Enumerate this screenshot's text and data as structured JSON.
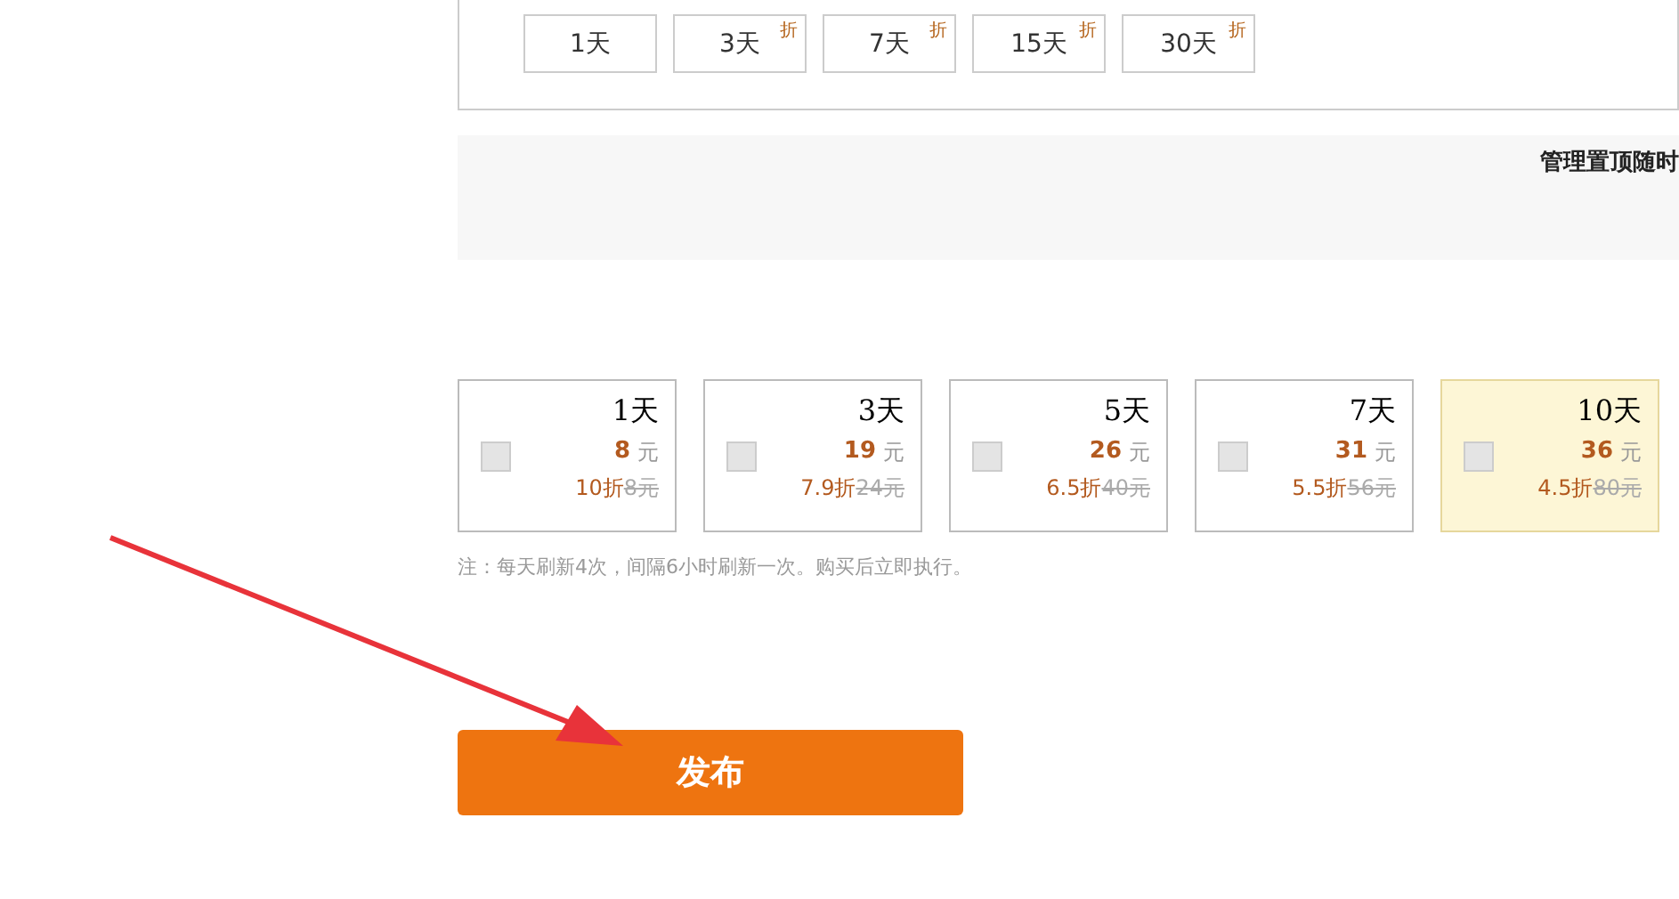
{
  "durations": [
    {
      "label": "1天"
    },
    {
      "label": "3天",
      "discount_mark": "折"
    },
    {
      "label": "7天",
      "discount_mark": "折"
    },
    {
      "label": "15天",
      "discount_mark": "折"
    },
    {
      "label": "30天",
      "discount_mark": "折"
    }
  ],
  "promo_fragment": "管理置顶随时",
  "refresh_plans": [
    {
      "days": "1天",
      "price": "8",
      "unit": "元",
      "discount": "10折",
      "original": "8元",
      "selected": false,
      "checked": false
    },
    {
      "days": "3天",
      "price": "19",
      "unit": "元",
      "discount": "7.9折",
      "original": "24元",
      "selected": false,
      "checked": false
    },
    {
      "days": "5天",
      "price": "26",
      "unit": "元",
      "discount": "6.5折",
      "original": "40元",
      "selected": false,
      "checked": false
    },
    {
      "days": "7天",
      "price": "31",
      "unit": "元",
      "discount": "5.5折",
      "original": "56元",
      "selected": false,
      "checked": false
    },
    {
      "days": "10天",
      "price": "36",
      "unit": "元",
      "discount": "4.5折",
      "original": "80元",
      "selected": true,
      "checked": false
    }
  ],
  "note": "注：每天刷新4次，间隔6小时刷新一次。购买后立即执行。",
  "publish_button": "发布"
}
